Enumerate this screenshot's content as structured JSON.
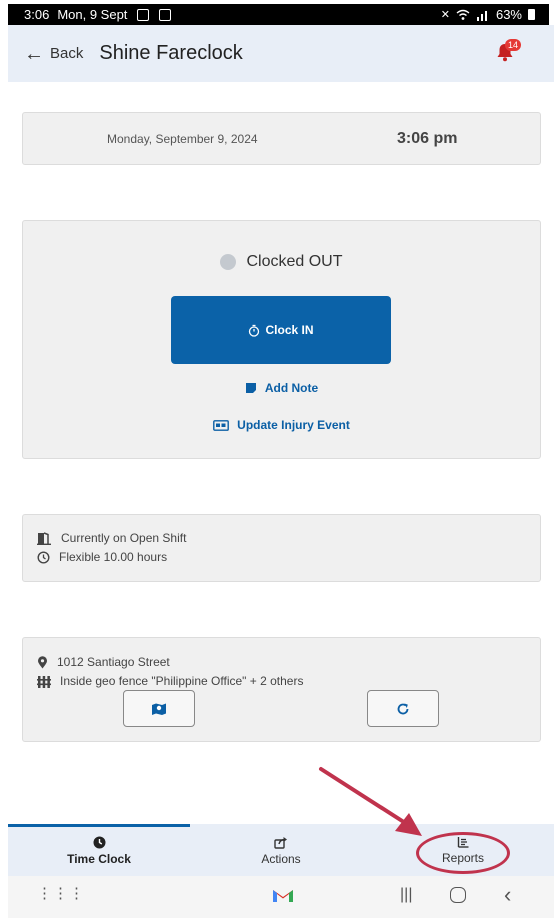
{
  "statusbar": {
    "time": "3:06",
    "date": "Mon, 9 Sept",
    "battery": "63%"
  },
  "appbar": {
    "back_label": "Back",
    "title": "Shine Fareclock",
    "notification_count": "14"
  },
  "datetime": {
    "date": "Monday, September 9, 2024",
    "time": "3:06 pm"
  },
  "clock": {
    "status": "Clocked OUT",
    "clock_in_label": "Clock IN",
    "add_note_label": "Add Note",
    "injury_label": "Update Injury Event"
  },
  "shift": {
    "current": "Currently on Open Shift",
    "hours": "Flexible 10.00 hours"
  },
  "location": {
    "address": "1012 Santiago Street",
    "geofence": "Inside geo fence \"Philippine Office\" + 2 others"
  },
  "tabs": [
    {
      "label": "Time Clock",
      "icon": "clock-icon",
      "active": true
    },
    {
      "label": "Actions",
      "icon": "share-icon",
      "active": false
    },
    {
      "label": "Reports",
      "icon": "reports-icon",
      "active": false
    }
  ],
  "colors": {
    "primary": "#0b62a8",
    "annotation": "#c0334d",
    "badge": "#e53935"
  }
}
